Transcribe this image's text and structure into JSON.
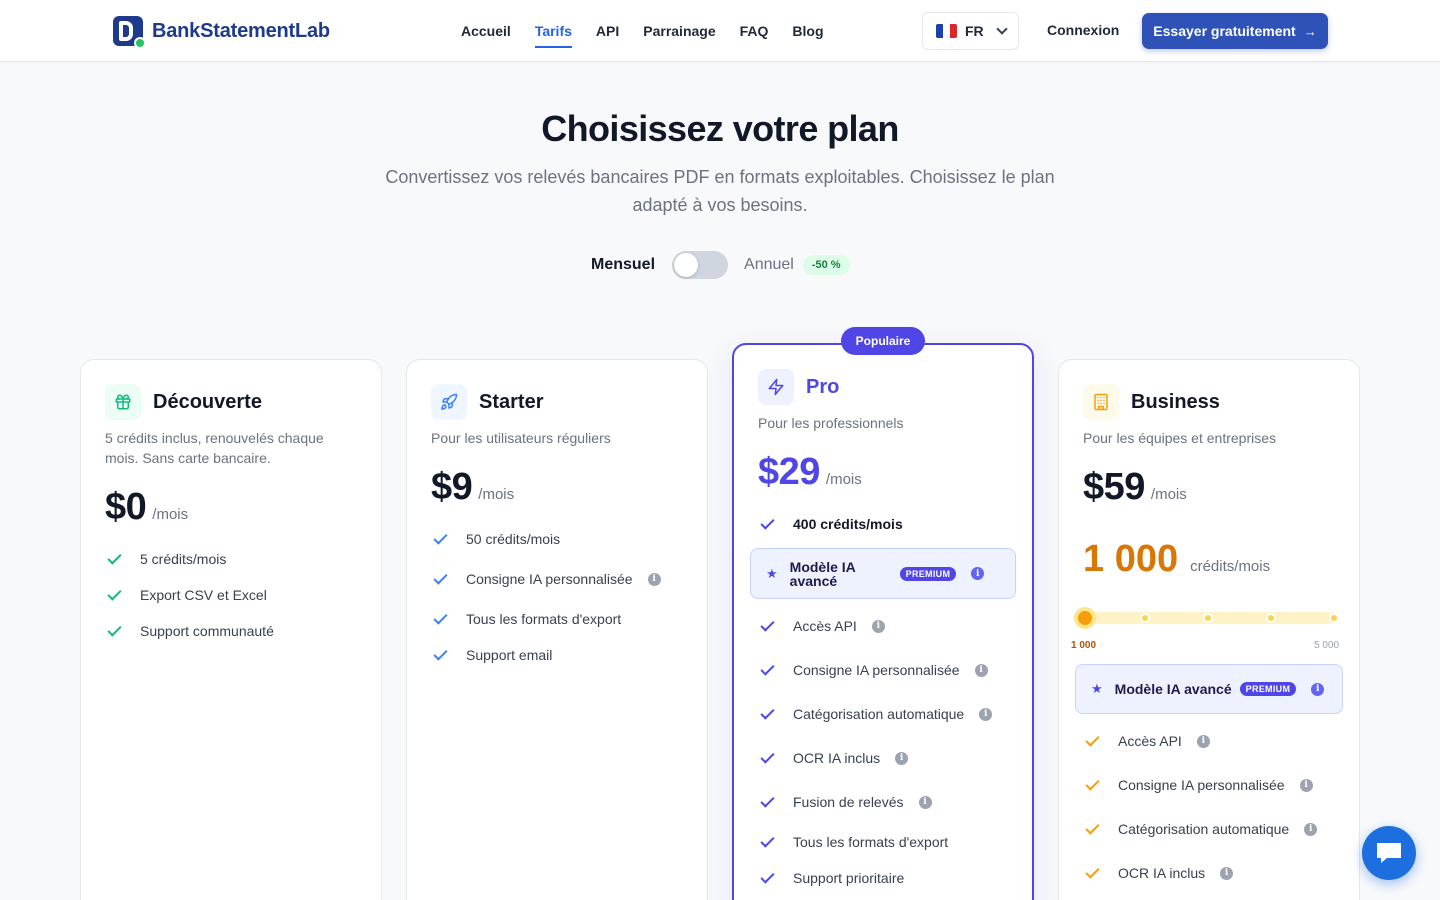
{
  "brand": {
    "name": "BankStatementLab"
  },
  "nav": {
    "items": [
      "Accueil",
      "Tarifs",
      "API",
      "Parrainage",
      "FAQ",
      "Blog"
    ],
    "active": "Tarifs"
  },
  "lang": {
    "code": "FR"
  },
  "header": {
    "login": "Connexion",
    "cta": "Essayer gratuitement",
    "cta_arrow": "→"
  },
  "hero": {
    "title": "Choisissez votre plan",
    "subtitle": "Convertissez vos relevés bancaires PDF en formats exploitables. Choisissez le plan adapté à vos besoins."
  },
  "billing": {
    "monthly": "Mensuel",
    "annual": "Annuel",
    "discount": "-50 %",
    "annual_selected": false
  },
  "plans": {
    "decouverte": {
      "name": "Découverte",
      "desc": "5 crédits inclus, renouvelés chaque mois. Sans carte bancaire.",
      "price": "$0",
      "per": "/mois",
      "features": [
        "5 crédits/mois",
        "Export CSV et Excel",
        "Support communauté"
      ]
    },
    "starter": {
      "name": "Starter",
      "desc": "Pour les utilisateurs réguliers",
      "price": "$9",
      "per": "/mois",
      "features": [
        "50 crédits/mois",
        "Consigne IA personnalisée",
        "Tous les formats d'export",
        "Support email"
      ]
    },
    "pro": {
      "badge": "Populaire",
      "name": "Pro",
      "desc": "Pour les professionnels",
      "price": "$29",
      "per": "/mois",
      "credits": "400 crédits/mois",
      "premium_label": "Modèle IA avancé",
      "premium_tag": "PREMIUM",
      "features": [
        "Accès API",
        "Consigne IA personnalisée",
        "Catégorisation automatique",
        "OCR IA inclus",
        "Fusion de relevés",
        "Tous les formats d'export",
        "Support prioritaire"
      ]
    },
    "business": {
      "name": "Business",
      "desc": "Pour les équipes et entreprises",
      "price": "$59",
      "per": "/mois",
      "credits_value": "1 000",
      "credits_unit": "crédits/mois",
      "slider_min": "1 000",
      "slider_max": "5 000",
      "slider_level": 0,
      "premium_label": "Modèle IA avancé",
      "premium_tag": "PREMIUM",
      "features": [
        "Accès API",
        "Consigne IA personnalisée",
        "Catégorisation automatique",
        "OCR IA inclus"
      ]
    }
  },
  "info_glyph": "i",
  "colors": {
    "brand": "#1e3a8a",
    "accent": "#2563eb",
    "pro": "#4f46e5",
    "business": "#d97706",
    "success": "#10b981"
  }
}
